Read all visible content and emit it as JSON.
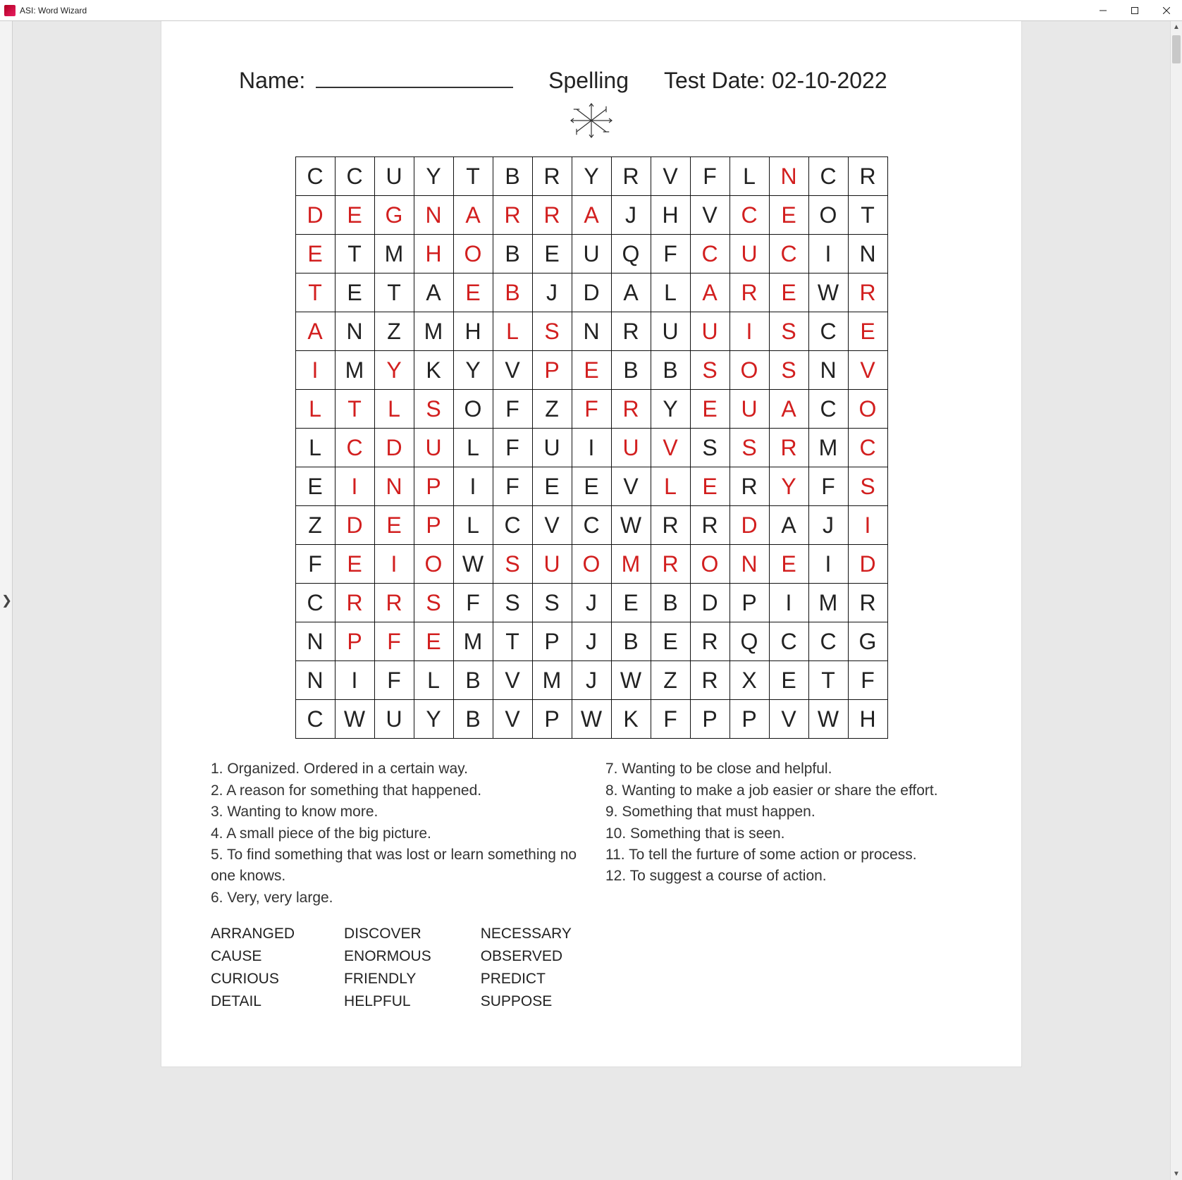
{
  "window": {
    "title": "ASI: Word Wizard"
  },
  "header": {
    "name_label": "Name:",
    "subject": "Spelling",
    "testdate_label": "Test Date:",
    "testdate_value": "02-10-2022"
  },
  "grid": {
    "cols": 15,
    "rows": 15,
    "cells": [
      [
        {
          "c": "C"
        },
        {
          "c": "C"
        },
        {
          "c": "U"
        },
        {
          "c": "Y"
        },
        {
          "c": "T"
        },
        {
          "c": "B"
        },
        {
          "c": "R"
        },
        {
          "c": "Y"
        },
        {
          "c": "R"
        },
        {
          "c": "V"
        },
        {
          "c": "F"
        },
        {
          "c": "L"
        },
        {
          "c": "N",
          "h": 1
        },
        {
          "c": "C"
        },
        {
          "c": "R"
        }
      ],
      [
        {
          "c": "D",
          "h": 1
        },
        {
          "c": "E",
          "h": 1
        },
        {
          "c": "G",
          "h": 1
        },
        {
          "c": "N",
          "h": 1
        },
        {
          "c": "A",
          "h": 1
        },
        {
          "c": "R",
          "h": 1
        },
        {
          "c": "R",
          "h": 1
        },
        {
          "c": "A",
          "h": 1
        },
        {
          "c": "J"
        },
        {
          "c": "H"
        },
        {
          "c": "V"
        },
        {
          "c": "C",
          "h": 1
        },
        {
          "c": "E",
          "h": 1
        },
        {
          "c": "O"
        },
        {
          "c": "T"
        }
      ],
      [
        {
          "c": "E",
          "h": 1
        },
        {
          "c": "T"
        },
        {
          "c": "M"
        },
        {
          "c": "H",
          "h": 1
        },
        {
          "c": "O",
          "h": 1
        },
        {
          "c": "B"
        },
        {
          "c": "E"
        },
        {
          "c": "U"
        },
        {
          "c": "Q"
        },
        {
          "c": "F"
        },
        {
          "c": "C",
          "h": 1
        },
        {
          "c": "U",
          "h": 1
        },
        {
          "c": "C",
          "h": 1
        },
        {
          "c": "I"
        },
        {
          "c": "N"
        }
      ],
      [
        {
          "c": "T",
          "h": 1
        },
        {
          "c": "E"
        },
        {
          "c": "T"
        },
        {
          "c": "A"
        },
        {
          "c": "E",
          "h": 1
        },
        {
          "c": "B",
          "h": 1
        },
        {
          "c": "J"
        },
        {
          "c": "D"
        },
        {
          "c": "A"
        },
        {
          "c": "L"
        },
        {
          "c": "A",
          "h": 1
        },
        {
          "c": "R",
          "h": 1
        },
        {
          "c": "E",
          "h": 1
        },
        {
          "c": "W"
        },
        {
          "c": "R",
          "h": 1
        }
      ],
      [
        {
          "c": "A",
          "h": 1
        },
        {
          "c": "N"
        },
        {
          "c": "Z"
        },
        {
          "c": "M"
        },
        {
          "c": "H"
        },
        {
          "c": "L",
          "h": 1
        },
        {
          "c": "S",
          "h": 1
        },
        {
          "c": "N"
        },
        {
          "c": "R"
        },
        {
          "c": "U"
        },
        {
          "c": "U",
          "h": 1
        },
        {
          "c": "I",
          "h": 1
        },
        {
          "c": "S",
          "h": 1
        },
        {
          "c": "C"
        },
        {
          "c": "E",
          "h": 1
        }
      ],
      [
        {
          "c": "I",
          "h": 1
        },
        {
          "c": "M"
        },
        {
          "c": "Y",
          "h": 1
        },
        {
          "c": "K"
        },
        {
          "c": "Y"
        },
        {
          "c": "V"
        },
        {
          "c": "P",
          "h": 1
        },
        {
          "c": "E",
          "h": 1
        },
        {
          "c": "B"
        },
        {
          "c": "B"
        },
        {
          "c": "S",
          "h": 1
        },
        {
          "c": "O",
          "h": 1
        },
        {
          "c": "S",
          "h": 1
        },
        {
          "c": "N"
        },
        {
          "c": "V",
          "h": 1
        }
      ],
      [
        {
          "c": "L",
          "h": 1
        },
        {
          "c": "T",
          "h": 1
        },
        {
          "c": "L",
          "h": 1
        },
        {
          "c": "S",
          "h": 1
        },
        {
          "c": "O"
        },
        {
          "c": "F"
        },
        {
          "c": "Z"
        },
        {
          "c": "F",
          "h": 1
        },
        {
          "c": "R",
          "h": 1
        },
        {
          "c": "Y"
        },
        {
          "c": "E",
          "h": 1
        },
        {
          "c": "U",
          "h": 1
        },
        {
          "c": "A",
          "h": 1
        },
        {
          "c": "C"
        },
        {
          "c": "O",
          "h": 1
        }
      ],
      [
        {
          "c": "L"
        },
        {
          "c": "C",
          "h": 1
        },
        {
          "c": "D",
          "h": 1
        },
        {
          "c": "U",
          "h": 1
        },
        {
          "c": "L"
        },
        {
          "c": "F"
        },
        {
          "c": "U"
        },
        {
          "c": "I"
        },
        {
          "c": "U",
          "h": 1
        },
        {
          "c": "V",
          "h": 1
        },
        {
          "c": "S"
        },
        {
          "c": "S",
          "h": 1
        },
        {
          "c": "R",
          "h": 1
        },
        {
          "c": "M"
        },
        {
          "c": "C",
          "h": 1
        }
      ],
      [
        {
          "c": "E"
        },
        {
          "c": "I",
          "h": 1
        },
        {
          "c": "N",
          "h": 1
        },
        {
          "c": "P",
          "h": 1
        },
        {
          "c": "I"
        },
        {
          "c": "F"
        },
        {
          "c": "E"
        },
        {
          "c": "E"
        },
        {
          "c": "V"
        },
        {
          "c": "L",
          "h": 1
        },
        {
          "c": "E",
          "h": 1
        },
        {
          "c": "R"
        },
        {
          "c": "Y",
          "h": 1
        },
        {
          "c": "F"
        },
        {
          "c": "S",
          "h": 1
        }
      ],
      [
        {
          "c": "Z"
        },
        {
          "c": "D",
          "h": 1
        },
        {
          "c": "E",
          "h": 1
        },
        {
          "c": "P",
          "h": 1
        },
        {
          "c": "L"
        },
        {
          "c": "C"
        },
        {
          "c": "V"
        },
        {
          "c": "C"
        },
        {
          "c": "W"
        },
        {
          "c": "R"
        },
        {
          "c": "R"
        },
        {
          "c": "D",
          "h": 1
        },
        {
          "c": "A"
        },
        {
          "c": "J"
        },
        {
          "c": "I",
          "h": 1
        }
      ],
      [
        {
          "c": "F"
        },
        {
          "c": "E",
          "h": 1
        },
        {
          "c": "I",
          "h": 1
        },
        {
          "c": "O",
          "h": 1
        },
        {
          "c": "W"
        },
        {
          "c": "S",
          "h": 1
        },
        {
          "c": "U",
          "h": 1
        },
        {
          "c": "O",
          "h": 1
        },
        {
          "c": "M",
          "h": 1
        },
        {
          "c": "R",
          "h": 1
        },
        {
          "c": "O",
          "h": 1
        },
        {
          "c": "N",
          "h": 1
        },
        {
          "c": "E",
          "h": 1
        },
        {
          "c": "I"
        },
        {
          "c": "D",
          "h": 1
        }
      ],
      [
        {
          "c": "C"
        },
        {
          "c": "R",
          "h": 1
        },
        {
          "c": "R",
          "h": 1
        },
        {
          "c": "S",
          "h": 1
        },
        {
          "c": "F"
        },
        {
          "c": "S"
        },
        {
          "c": "S"
        },
        {
          "c": "J"
        },
        {
          "c": "E"
        },
        {
          "c": "B"
        },
        {
          "c": "D"
        },
        {
          "c": "P"
        },
        {
          "c": "I"
        },
        {
          "c": "M"
        },
        {
          "c": "R"
        }
      ],
      [
        {
          "c": "N"
        },
        {
          "c": "P",
          "h": 1
        },
        {
          "c": "F",
          "h": 1
        },
        {
          "c": "E",
          "h": 1
        },
        {
          "c": "M"
        },
        {
          "c": "T"
        },
        {
          "c": "P"
        },
        {
          "c": "J"
        },
        {
          "c": "B"
        },
        {
          "c": "E"
        },
        {
          "c": "R"
        },
        {
          "c": "Q"
        },
        {
          "c": "C"
        },
        {
          "c": "C"
        },
        {
          "c": "G"
        }
      ],
      [
        {
          "c": "N"
        },
        {
          "c": "I"
        },
        {
          "c": "F"
        },
        {
          "c": "L"
        },
        {
          "c": "B"
        },
        {
          "c": "V"
        },
        {
          "c": "M"
        },
        {
          "c": "J"
        },
        {
          "c": "W"
        },
        {
          "c": "Z"
        },
        {
          "c": "R"
        },
        {
          "c": "X"
        },
        {
          "c": "E"
        },
        {
          "c": "T"
        },
        {
          "c": "F"
        }
      ],
      [
        {
          "c": "C"
        },
        {
          "c": "W"
        },
        {
          "c": "U"
        },
        {
          "c": "Y"
        },
        {
          "c": "B"
        },
        {
          "c": "V"
        },
        {
          "c": "P"
        },
        {
          "c": "W"
        },
        {
          "c": "K"
        },
        {
          "c": "F"
        },
        {
          "c": "P"
        },
        {
          "c": "P"
        },
        {
          "c": "V"
        },
        {
          "c": "W"
        },
        {
          "c": "H"
        }
      ]
    ]
  },
  "clues_left": [
    "1. Organized.  Ordered in a certain way.",
    "2. A reason for something that happened.",
    "3. Wanting to know more.",
    "4. A small piece of the big picture.",
    "5. To find something that was lost or learn something no one knows.",
    "6. Very, very large."
  ],
  "clues_right": [
    "7. Wanting to be close and helpful.",
    "8. Wanting to make a job easier or share the effort.",
    "9. Something that must happen.",
    "10. Something that is seen.",
    "11. To tell the furture of some action or process.",
    "12. To suggest a course of action."
  ],
  "bank": [
    [
      "ARRANGED",
      "CAUSE",
      "CURIOUS",
      "DETAIL"
    ],
    [
      "DISCOVER",
      "ENORMOUS",
      "FRIENDLY",
      "HELPFUL"
    ],
    [
      "NECESSARY",
      "OBSERVED",
      "PREDICT",
      "SUPPOSE"
    ]
  ]
}
